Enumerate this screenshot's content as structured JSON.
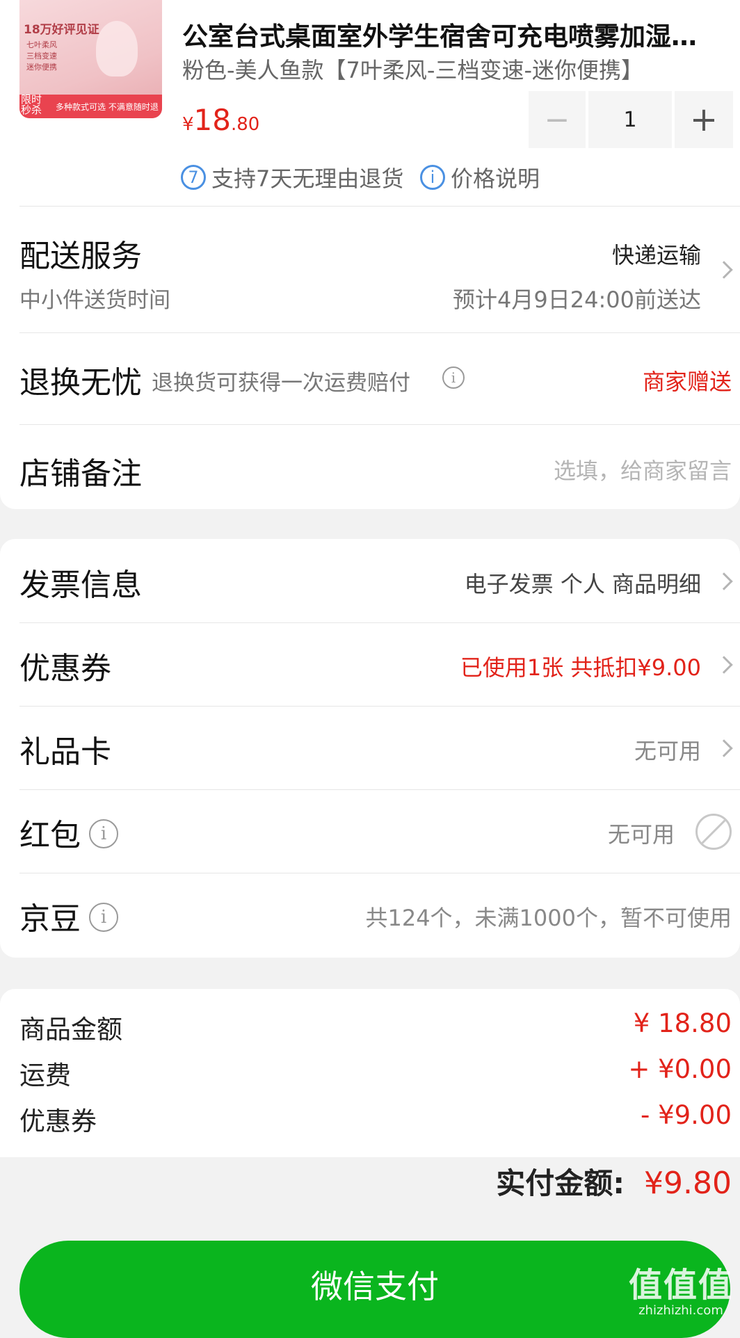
{
  "product": {
    "image_text": {
      "headline": "18万好评见证",
      "bullets": [
        "七叶柔风",
        "三档变速",
        "迷你便携"
      ],
      "badge": "限时秒杀",
      "banner": "多种款式可选 不满意随时退"
    },
    "title": "公室台式桌面室外学生宿舍可充电喷雾加湿…",
    "spec": "粉色-美人鱼款【7叶柔风-三档变速-迷你便携】",
    "price": {
      "currency": "¥",
      "integer": "18",
      "decimal": ".80"
    },
    "quantity": "1",
    "minus_label": "−",
    "plus_label": "+",
    "service_badges": [
      {
        "icon": "7",
        "label": "支持7天无理由退货"
      },
      {
        "icon": "i",
        "label": "价格说明"
      }
    ]
  },
  "delivery": {
    "title": "配送服务",
    "method": "快递运输",
    "subtitle": "中小件送货时间",
    "eta": "预计4月9日24:00前送达"
  },
  "returns": {
    "title": "退换无忧",
    "desc": "退换货可获得一次运费赔付",
    "value": "商家赠送"
  },
  "store_note": {
    "title": "店铺备注",
    "placeholder": "选填，给商家留言"
  },
  "options": [
    {
      "label": "发票信息",
      "value": "电子发票 个人 商品明细"
    },
    {
      "label": "优惠券",
      "value": "已使用1张 共抵扣¥9.00"
    },
    {
      "label": "礼品卡",
      "value": "无可用"
    },
    {
      "label": "红包",
      "value": "无可用"
    },
    {
      "label": "京豆",
      "value": "共124个，未满1000个，暂不可使用"
    }
  ],
  "summary": [
    {
      "label": "商品金额",
      "value": "¥ 18.80"
    },
    {
      "label": "运费",
      "value": "+ ¥0.00"
    },
    {
      "label": "优惠券",
      "value": "- ¥9.00"
    }
  ],
  "total": {
    "label": "实付金额:",
    "value": "¥9.80"
  },
  "pay_button": "微信支付",
  "watermark": {
    "logo": "值值值",
    "site": "zhizhizhi.com"
  },
  "colors": {
    "accent_red": "#e2231a",
    "pay_green": "#0ab51e",
    "link_blue": "#4a90e2"
  }
}
